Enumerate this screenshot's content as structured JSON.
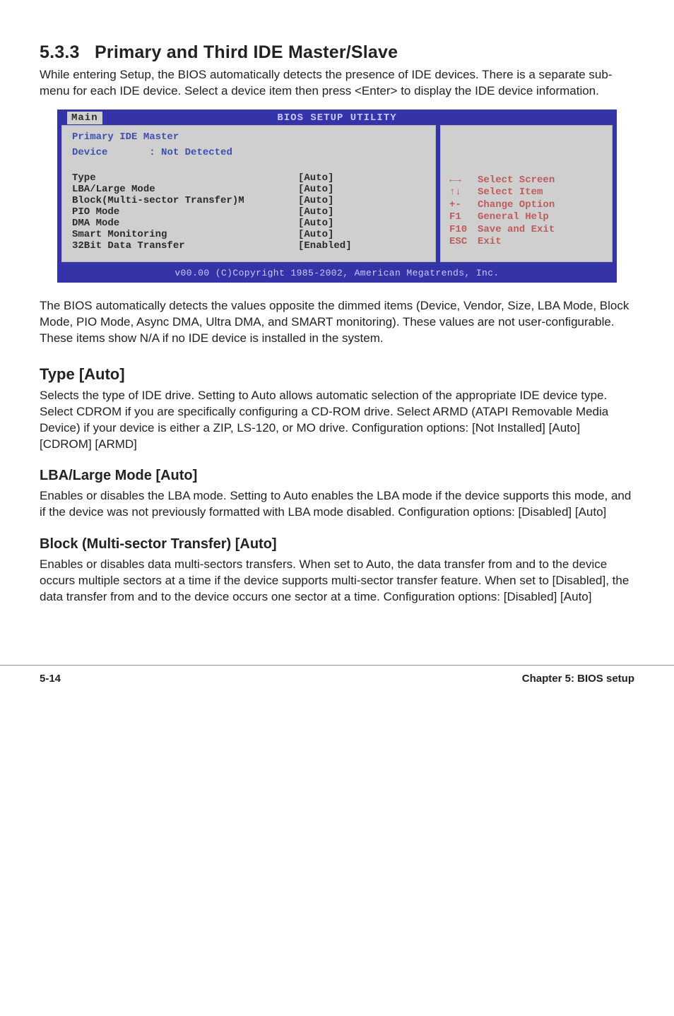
{
  "section": {
    "number": "5.3.3",
    "title": "Primary and Third IDE Master/Slave",
    "intro": "While entering Setup, the BIOS automatically detects the presence of IDE devices. There is a separate sub-menu for each IDE device. Select a device item then press <Enter> to display the IDE device information."
  },
  "bios": {
    "utility_title": "BIOS SETUP UTILITY",
    "tab": "Main",
    "panel_title": "Primary IDE Master",
    "device_label": "Device",
    "device_value": ": Not Detected",
    "rows": [
      {
        "label": "Type",
        "value": "[Auto]"
      },
      {
        "label": "LBA/Large Mode",
        "value": "[Auto]"
      },
      {
        "label": "Block(Multi-sector Transfer)M",
        "value": "[Auto]"
      },
      {
        "label": "PIO Mode",
        "value": "[Auto]"
      },
      {
        "label": "DMA Mode",
        "value": "[Auto]"
      },
      {
        "label": "Smart Monitoring",
        "value": "[Auto]"
      },
      {
        "label": "32Bit Data Transfer",
        "value": "[Enabled]"
      }
    ],
    "help": [
      {
        "key": "←→",
        "desc": "Select Screen"
      },
      {
        "key": "↑↓",
        "desc": "Select Item"
      },
      {
        "key": "+-",
        "desc": "Change Option"
      },
      {
        "key": "F1",
        "desc": "General Help"
      },
      {
        "key": "F10",
        "desc": "Save and Exit"
      },
      {
        "key": "ESC",
        "desc": "Exit"
      }
    ],
    "footer": "v00.00 (C)Copyright 1985-2002, American Megatrends, Inc."
  },
  "after_bios_text": "The BIOS automatically detects the values opposite the dimmed items (Device, Vendor, Size, LBA Mode, Block Mode, PIO Mode, Async DMA, Ultra DMA, and SMART monitoring). These values are not user-configurable. These items show N/A if no IDE device is installed in the system.",
  "sections": [
    {
      "heading": "Type [Auto]",
      "text": "Selects the type of IDE drive. Setting to Auto allows automatic selection of the appropriate IDE device type. Select CDROM if you are specifically configuring a CD-ROM drive. Select ARMD (ATAPI Removable Media Device) if your device is either a ZIP, LS-120, or MO drive. Configuration options: [Not Installed] [Auto] [CDROM] [ARMD]"
    },
    {
      "heading": "LBA/Large Mode [Auto]",
      "text": "Enables or disables the LBA mode. Setting to Auto enables the LBA mode if the device supports this mode, and if the device was not previously formatted with LBA mode disabled. Configuration options: [Disabled] [Auto]"
    },
    {
      "heading": "Block (Multi-sector Transfer) [Auto]",
      "text": "Enables or disables data multi-sectors transfers. When set to Auto, the data transfer from and to the device occurs multiple sectors at a time if the device supports multi-sector transfer feature. When set to [Disabled], the data transfer from and to the device occurs one sector at a time. Configuration options: [Disabled] [Auto]"
    }
  ],
  "page_footer": {
    "left": "5-14",
    "right": "Chapter 5: BIOS setup"
  }
}
